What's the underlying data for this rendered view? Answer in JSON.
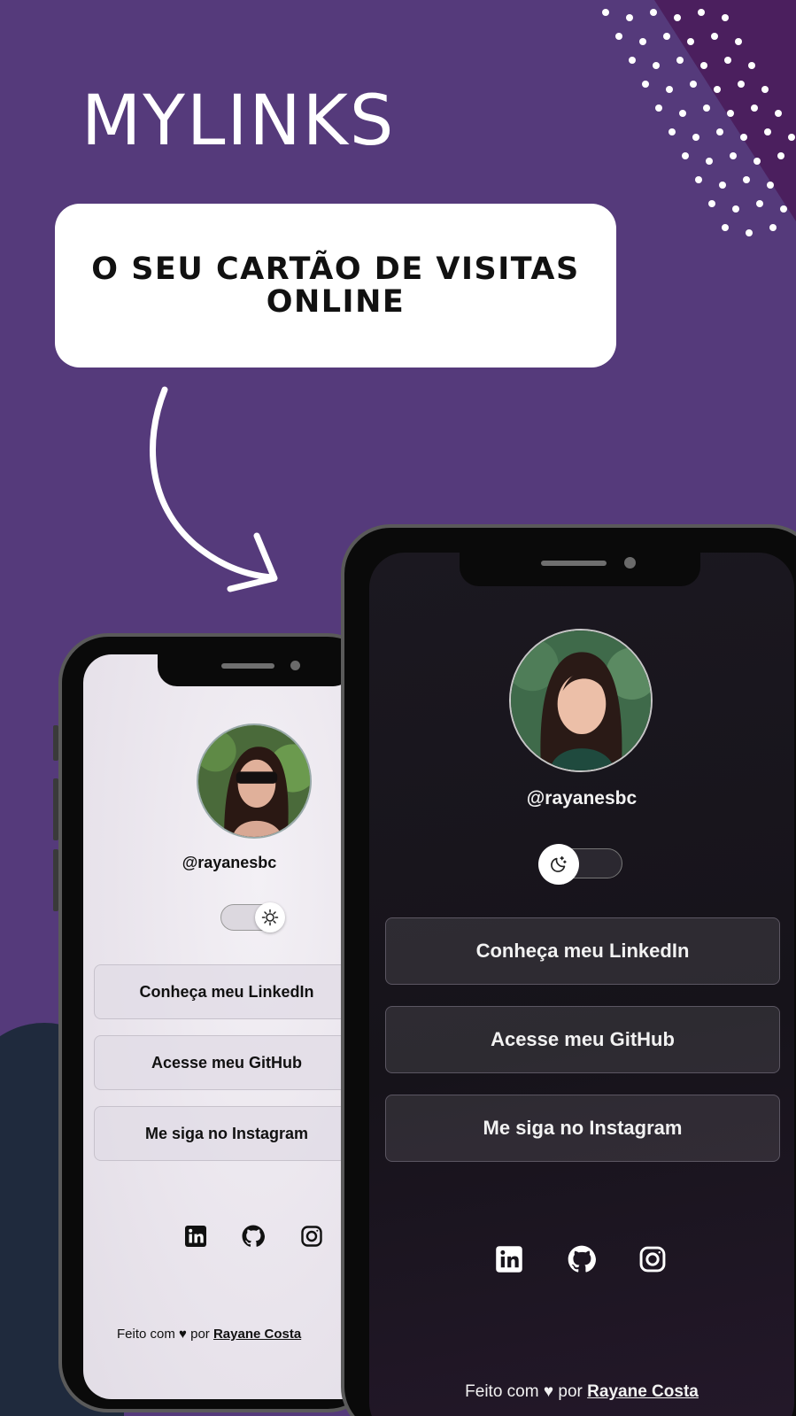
{
  "hero": {
    "brand": "MYLINKS",
    "tagline": "O SEU CARTÃO DE VISITAS ONLINE"
  },
  "light_phone": {
    "handle": "@rayanesbc",
    "theme_toggle_icon": "sun-icon",
    "buttons": [
      {
        "label": "Conheça meu LinkedIn"
      },
      {
        "label": "Acesse meu GitHub"
      },
      {
        "label": "Me siga no Instagram"
      }
    ],
    "social": [
      "linkedin-icon",
      "github-icon",
      "instagram-icon"
    ],
    "footer": {
      "prefix": "Feito com",
      "heart": "♥",
      "by": "por",
      "author": "Rayane Costa"
    }
  },
  "dark_phone": {
    "handle": "@rayanesbc",
    "theme_toggle_icon": "moon-icon",
    "buttons": [
      {
        "label": "Conheça meu LinkedIn"
      },
      {
        "label": "Acesse meu GitHub"
      },
      {
        "label": "Me siga no Instagram"
      }
    ],
    "social": [
      "linkedin-icon",
      "github-icon",
      "instagram-icon"
    ],
    "footer": {
      "prefix": "Feito com",
      "heart": "♥",
      "by": "por",
      "author": "Rayane Costa"
    }
  },
  "colors": {
    "background": "#553a7b",
    "corner_accent": "#4b1f5e",
    "bottom_blob": "#1f2a3d",
    "card": "#ffffff"
  }
}
